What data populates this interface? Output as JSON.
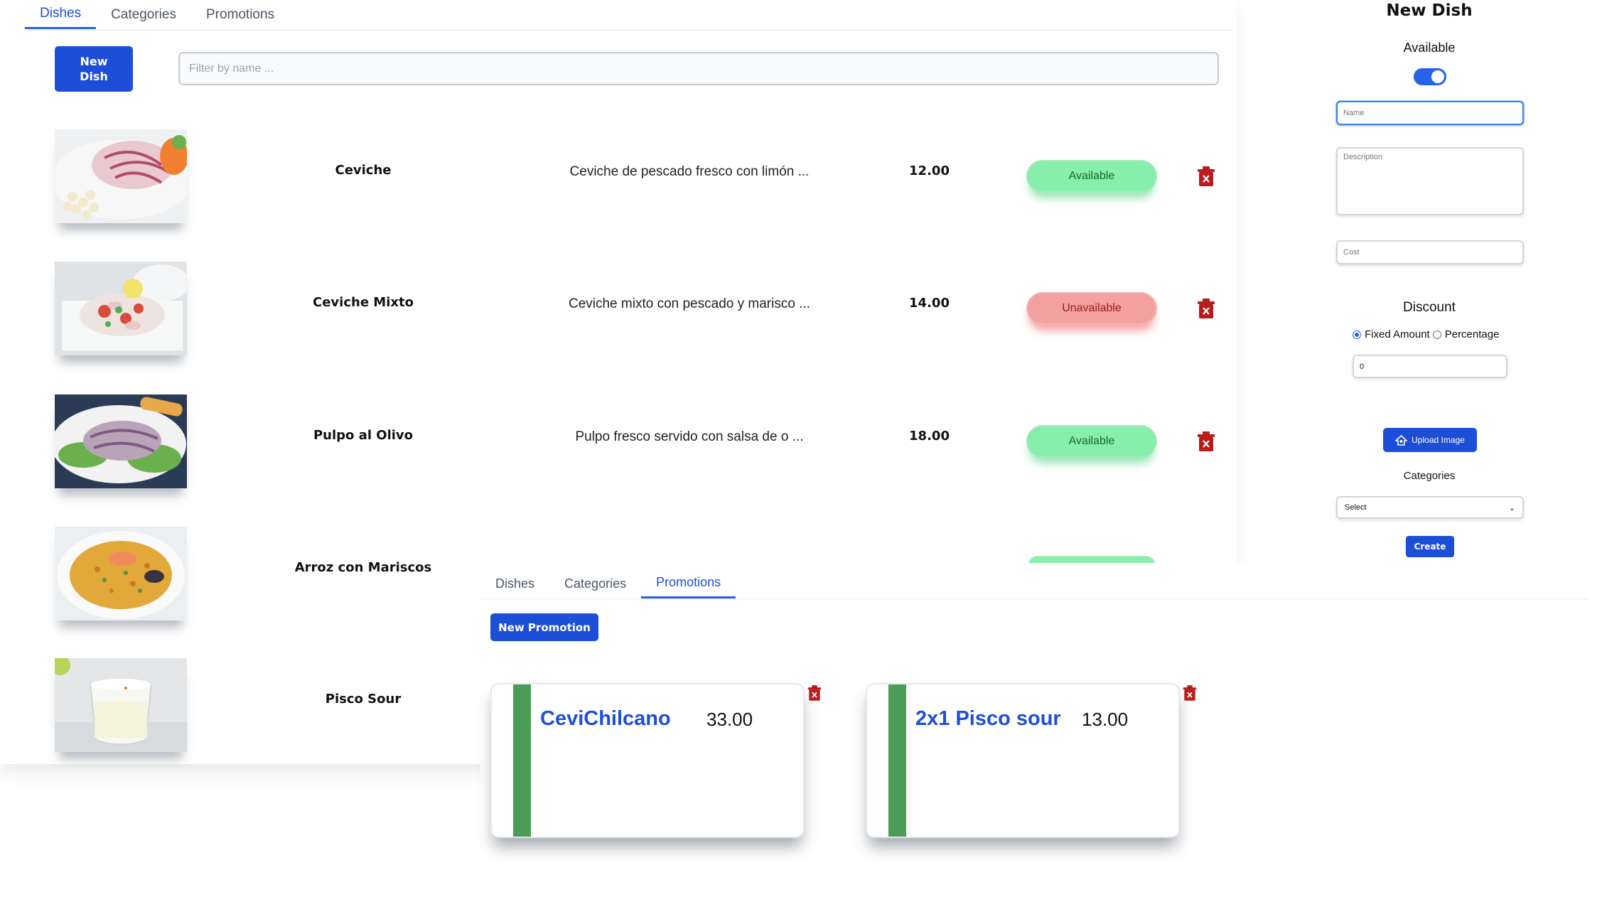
{
  "dishes_view": {
    "tabs": [
      {
        "label": "Dishes",
        "active": true
      },
      {
        "label": "Categories",
        "active": false
      },
      {
        "label": "Promotions",
        "active": false
      }
    ],
    "new_dish_label": "New Dish",
    "filter_placeholder": "Filter by name ...",
    "dishes": [
      {
        "name": "Ceviche",
        "description": "Ceviche de pescado fresco con limón ...",
        "price": "12.00",
        "status": "Available"
      },
      {
        "name": "Ceviche Mixto",
        "description": "Ceviche mixto con pescado y marisco ...",
        "price": "14.00",
        "status": "Unavailable"
      },
      {
        "name": "Pulpo al Olivo",
        "description": "Pulpo fresco servido con salsa de o ...",
        "price": "18.00",
        "status": "Available"
      },
      {
        "name": "Arroz con Mariscos"
      },
      {
        "name": "Pisco Sour"
      }
    ],
    "colors": {
      "available": "#86efac",
      "unavailable": "#f3a0a0",
      "delete": "#b91c1c",
      "primary": "#1d4ed8"
    }
  },
  "new_dish_form": {
    "title": "New Dish",
    "available_label": "Available",
    "available": true,
    "name_placeholder": "Name",
    "description_placeholder": "Description",
    "cost_placeholder": "Cost",
    "discount_label": "Discount",
    "discount_options": [
      "Fixed Amount",
      "Percentage"
    ],
    "discount_selected": "Fixed Amount",
    "discount_value": "0",
    "upload_label": "Upload Image",
    "categories_label": "Categories",
    "categories_selected": "Select",
    "create_label": "Create"
  },
  "promotions_view": {
    "tabs": [
      {
        "label": "Dishes",
        "active": false
      },
      {
        "label": "Categories",
        "active": false
      },
      {
        "label": "Promotions",
        "active": true
      }
    ],
    "new_promotion_label": "New Promotion",
    "promotions": [
      {
        "name": "CeviChilcano",
        "price": "33.00"
      },
      {
        "name": "2x1 Pisco sour",
        "price": "13.00"
      }
    ],
    "stripe_color": "#4a9d56"
  }
}
